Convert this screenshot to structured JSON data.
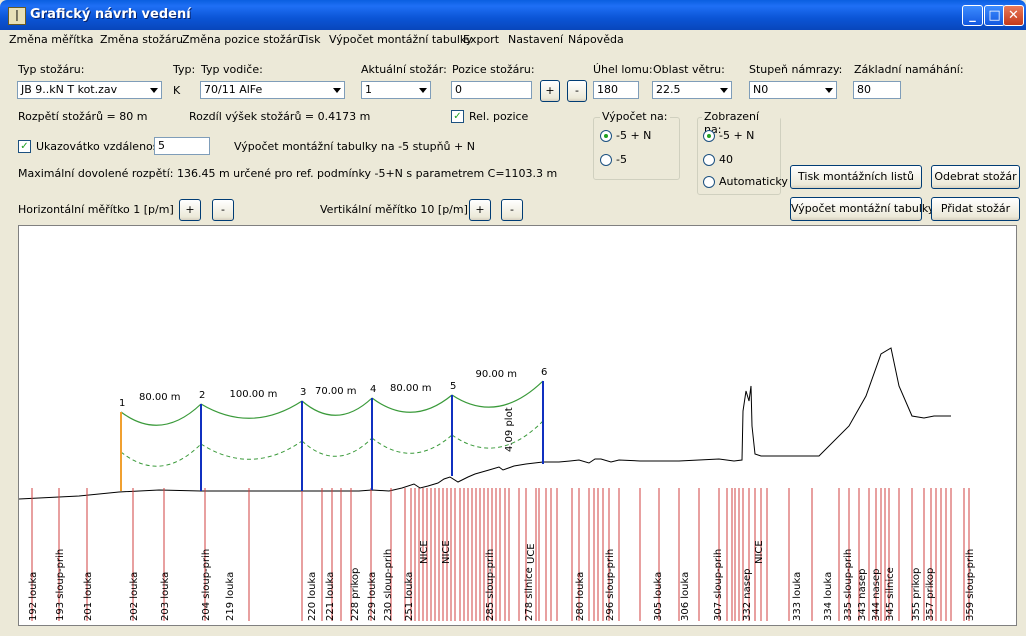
{
  "window": {
    "title": "Grafický návrh vedení",
    "icon": "tower-icon",
    "controls": [
      "minimize",
      "maximize",
      "close"
    ]
  },
  "menu": [
    {
      "label": "Změna měřítka"
    },
    {
      "label": "Změna stožáru"
    },
    {
      "label": "Změna pozice stožáru"
    },
    {
      "label": "Tisk"
    },
    {
      "label": "Výpočet montážní tabulky"
    },
    {
      "label": "Export"
    },
    {
      "label": "Nastavení"
    },
    {
      "label": "Nápověda"
    }
  ],
  "form": {
    "typ_stozaru_label": "Typ stožáru:",
    "typ_stozaru_value": "JB 9..kN T kot.zav",
    "typ_label": "Typ:",
    "typ_value": "K",
    "typ_vodice_label": "Typ vodiče:",
    "typ_vodice_value": "70/11 AlFe",
    "aktualni_label": "Aktuální stožár:",
    "aktualni_value": "1",
    "pozice_label": "Pozice stožáru:",
    "pozice_value": "0",
    "plus": "+",
    "minus": "-",
    "uhel_label": "Úhel lomu:",
    "uhel_value": "180",
    "oblast_label": "Oblast větru:",
    "oblast_value": "22.5",
    "namraza_label": "Stupeň námrazy:",
    "namraza_value": "N0",
    "zakladni_label": "Základní namáhání:",
    "zakladni_value": "80",
    "rozpeti_text": "Rozpětí stožárů = 80 m",
    "rozdil_text": "Rozdíl výšek stožárů = 0.4173 m",
    "rel_pozice_label": "Rel. pozice",
    "rel_pozice_checked": true,
    "ukazovatko_label": "Ukazovátko vzdálenosti",
    "ukazovatko_checked": true,
    "ukazovatko_value": "5",
    "vypocet_info": "Výpočet montážní tabulky na -5 stupňů + N",
    "max_info": "Maximální dovolené rozpětí: 136.45 m určené pro ref. podmínky -5+N s parametrem C=1103.3 m",
    "horiz_label": "Horizontální měřítko 1 [p/m]",
    "vert_label": "Vertikální měřítko 10 [p/m]",
    "vypocet_group": {
      "title": "Výpočet na:",
      "options": [
        "-5 + N",
        "-5"
      ],
      "selected": 0
    },
    "zobrazeni_group": {
      "title": "Zobrazení na:",
      "options": [
        "-5 + N",
        "40",
        "Automaticky"
      ],
      "selected": 0
    },
    "btn_tisk": "Tisk montážních listů",
    "btn_odebrat": "Odebrat stožár",
    "btn_vypocet": "Výpočet montážní tabulky",
    "btn_pridat": "Přidat stožár"
  },
  "profile": {
    "towers": [
      {
        "id": "1",
        "color": "#f0a030"
      },
      {
        "id": "2",
        "color": "#1030c0"
      },
      {
        "id": "3",
        "color": "#1030c0"
      },
      {
        "id": "4",
        "color": "#1030c0"
      },
      {
        "id": "5",
        "color": "#1030c0"
      },
      {
        "id": "6",
        "color": "#1030c0"
      }
    ],
    "spans": [
      "80.00 m",
      "100.00 m",
      "70.00 m",
      "80.00 m",
      "90.00 m"
    ],
    "annotation": "4.09 plot",
    "sag_color": "#3a9a3a",
    "terrain_color": "#000000",
    "marker_color": "#d04040",
    "labels": [
      "192 louka",
      "193 sloup-prih",
      "201 louka",
      "202 louka",
      "203 louka",
      "204 sloup-prih",
      "219 louka",
      "220 louka",
      "221 louka",
      "228 prikop",
      "229 louka",
      "230 sloup-prih",
      "251 louka",
      "285 sloup-prih",
      "278 silnice",
      "280 louka",
      "296 sloup-prih",
      "305 louka",
      "306 louka",
      "307 sloup-prih",
      "332 nasep",
      "333 louka",
      "334 louka",
      "335 sloup-prih",
      "343 nasep",
      "344 nasep",
      "345 silnice",
      "355 prikop",
      "357 prikop",
      "359 sloup-prih"
    ],
    "crossing_labels": [
      "NICE",
      "NICE",
      "UCE",
      "NICE"
    ]
  }
}
